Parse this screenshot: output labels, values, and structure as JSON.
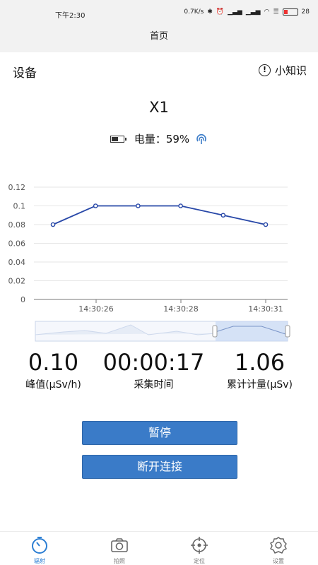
{
  "status_bar": {
    "time": "下午2:30",
    "speed": "0.7K/s",
    "battery": "28"
  },
  "title_bar": {
    "title": "首页"
  },
  "header": {
    "left_label": "设备",
    "tips_label": "小知识"
  },
  "device": {
    "name": "X1",
    "battery_label": "电量：59%"
  },
  "chart_data": {
    "type": "line",
    "x": [
      "14:30:25",
      "14:30:26",
      "14:30:27",
      "14:30:28",
      "14:30:29",
      "14:30:30"
    ],
    "x_tick_labels": [
      "14:30:26",
      "14:30:28",
      "14:30:31"
    ],
    "y_tick_labels": [
      "0",
      "0.02",
      "0.04",
      "0.06",
      "0.08",
      "0.1",
      "0.12"
    ],
    "values": [
      0.08,
      0.1,
      0.1,
      0.1,
      0.09,
      0.08
    ],
    "ylim": [
      0,
      0.12
    ],
    "grid": true,
    "line_color": "#2848a8",
    "title": "",
    "xlabel": "",
    "ylabel": ""
  },
  "readouts": {
    "peak": {
      "value": "0.10",
      "label": "峰值(μSv/h)"
    },
    "duration": {
      "value": "00:00:17",
      "label": "采集时间"
    },
    "cumulative": {
      "value": "1.06",
      "label": "累计计量(μSv)"
    }
  },
  "buttons": {
    "pause": "暂停",
    "disconnect": "断开连接"
  },
  "tabbar": {
    "items": [
      {
        "label": "辐射",
        "icon": "timer-icon",
        "active": true
      },
      {
        "label": "拍照",
        "icon": "camera-icon",
        "active": false
      },
      {
        "label": "定位",
        "icon": "crosshair-icon",
        "active": false
      },
      {
        "label": "设置",
        "icon": "gear-icon",
        "active": false
      }
    ]
  },
  "colors": {
    "accent": "#3a7bc8",
    "tab_active": "#2d7fd3"
  }
}
